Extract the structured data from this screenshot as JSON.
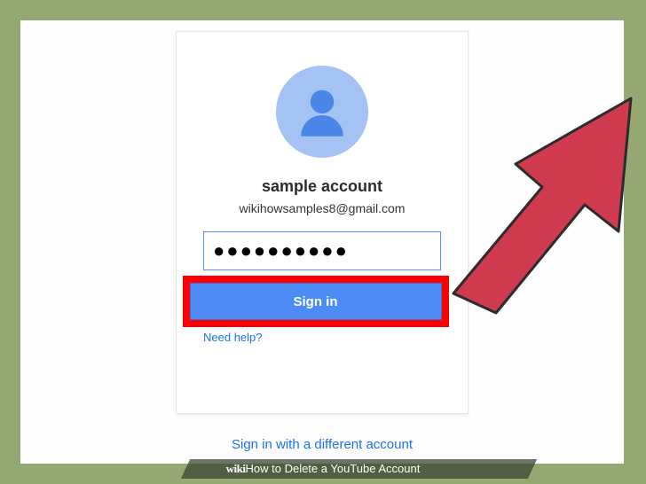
{
  "card": {
    "account_name": "sample account",
    "account_email": "wikihowsamples8@gmail.com",
    "password_value": "●●●●●●●●●●",
    "signin_label": "Sign in",
    "help_label": "Need help?"
  },
  "alt_account_label": "Sign in with a different account",
  "caption": {
    "logo": "wiki",
    "title": "How to Delete a YouTube Account"
  },
  "colors": {
    "highlight": "#ff0000",
    "button": "#4d8cf5",
    "link": "#1a73e8",
    "avatar_bg": "#a4c2f4",
    "avatar_fg": "#4a86e8",
    "arrow_fill": "#cf3a4e",
    "frame_bg": "#95a873"
  }
}
